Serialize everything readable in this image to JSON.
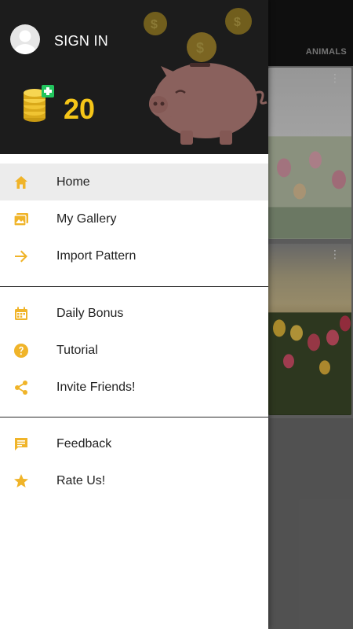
{
  "header": {
    "signin_label": "SIGN IN",
    "coins": "20"
  },
  "background": {
    "tab_label": "ANIMALS"
  },
  "menu": {
    "groups": [
      [
        {
          "label": "Home",
          "icon": "home-icon"
        },
        {
          "label": "My Gallery",
          "icon": "gallery-icon"
        },
        {
          "label": "Import Pattern",
          "icon": "arrow-right-icon"
        }
      ],
      [
        {
          "label": "Daily Bonus",
          "icon": "calendar-icon"
        },
        {
          "label": "Tutorial",
          "icon": "help-icon"
        },
        {
          "label": "Invite Friends!",
          "icon": "share-icon"
        }
      ],
      [
        {
          "label": "Feedback",
          "icon": "feedback-icon"
        },
        {
          "label": "Rate Us!",
          "icon": "star-icon"
        }
      ]
    ]
  },
  "colors": {
    "accent": "#f0b429",
    "coin_text": "#f5c518",
    "header_bg": "#1c1c1c",
    "active_bg": "#ececec"
  }
}
